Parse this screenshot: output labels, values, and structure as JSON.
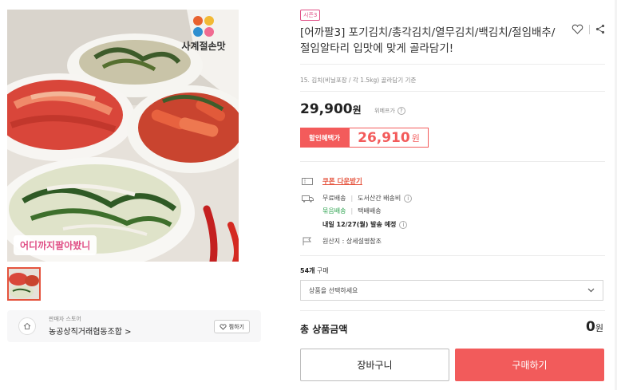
{
  "product_image": {
    "brand_name": "사계절손맛",
    "promo_tag": "어디까지팔아봤니",
    "brand_dot_colors": [
      "#e8622f",
      "#f2b934",
      "#2f8fd0",
      "#f06b91"
    ]
  },
  "seller": {
    "type_label": "판매자 스토어",
    "name": "농공상직거래협동조합 >",
    "follow_label": "찜하기"
  },
  "product": {
    "badge": "시즌3",
    "title": "[어까팔3] 포기김치/총각김치/열무김치/백김치/절임배추/절임알타리 입맛에 맞게 골라담기!",
    "subtitle": "15. 김치(비닐포장 / 각 1.5kg) 골라담기 기준",
    "price": "29,900",
    "price_unit": "원",
    "price_note": "위메프가",
    "discount_label": "할인혜택가",
    "discount_price": "26,910",
    "discount_unit": "원"
  },
  "coupon": {
    "label": "쿠폰 다운받기"
  },
  "shipping": {
    "free": "무료배송",
    "extra": "도서산간 배송비",
    "bundle": "묶음배송",
    "courier": "택배배송",
    "dispatch": "내일 12/27(월) 발송 예정"
  },
  "origin": {
    "text": "원산지 : 상세설명참조"
  },
  "purchase": {
    "count": "54개",
    "count_suffix": "구매",
    "select_placeholder": "상품을 선택하세요"
  },
  "total": {
    "label": "총 상품금액",
    "value": "0",
    "unit": "원"
  },
  "buttons": {
    "cart": "장바구니",
    "buy": "구매하기"
  },
  "colors": {
    "accent_red": "#f25b5b",
    "pink": "#e04f86",
    "green": "#2aa14c"
  }
}
